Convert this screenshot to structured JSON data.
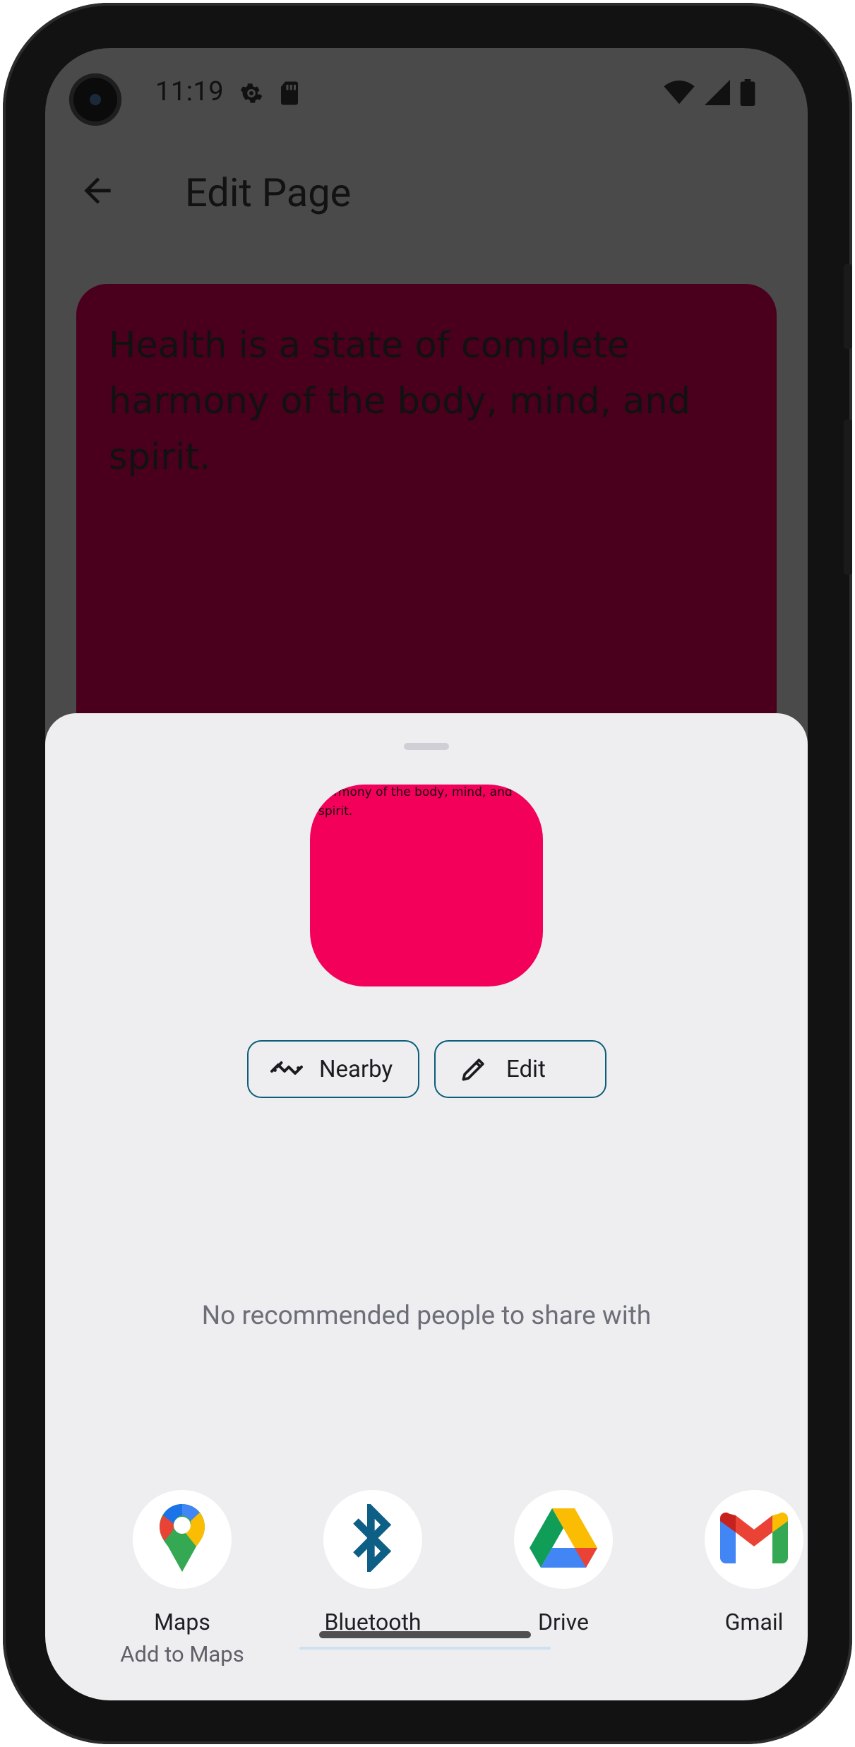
{
  "status_bar": {
    "time": "11:19",
    "left_icons": [
      "settings-gear-icon",
      "sd-card-icon"
    ],
    "right_icons": [
      "wifi-icon",
      "cell-signal-icon",
      "battery-icon"
    ]
  },
  "app_bar": {
    "title": "Edit Page",
    "back_icon": "arrow-left-icon"
  },
  "quote": {
    "text": "Health is a state of complete harmony of the body, mind, and spirit.",
    "card_color": "#4a001c"
  },
  "share_sheet": {
    "preview_text": "harmony of the body, mind, and spirit.",
    "preview_color": "#f2005a",
    "actions": [
      {
        "label": "Nearby",
        "icon": "nearby-share-icon"
      },
      {
        "label": "Edit",
        "icon": "pencil-icon"
      }
    ],
    "empty_message": "No recommended people to share with",
    "targets": [
      {
        "name": "Maps",
        "sub": "Add to Maps",
        "icon": "google-maps-icon"
      },
      {
        "name": "Bluetooth",
        "sub": "",
        "icon": "bluetooth-icon"
      },
      {
        "name": "Drive",
        "sub": "",
        "icon": "google-drive-icon"
      },
      {
        "name": "Gmail",
        "sub": "",
        "icon": "gmail-icon"
      }
    ]
  },
  "colors": {
    "accent_outline": "#0b5d79",
    "sheet_background": "#eeeef1",
    "scrim": "#4a4a4a"
  }
}
